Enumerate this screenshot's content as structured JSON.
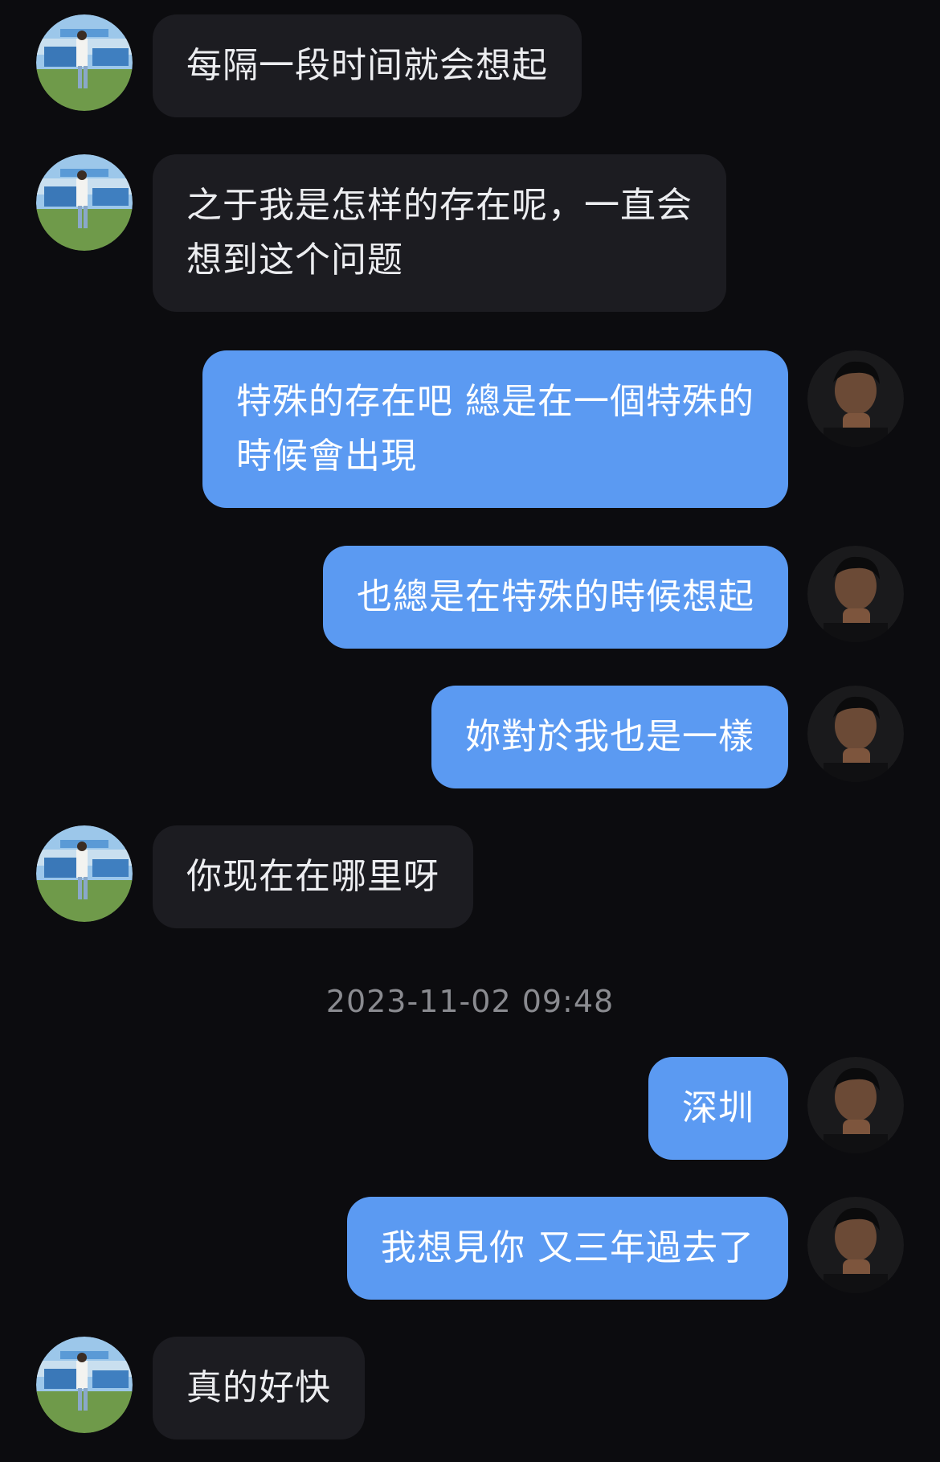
{
  "contacts": {
    "her": {
      "avatar_icon": "avatar-photo-girl-field"
    },
    "me": {
      "avatar_icon": "avatar-photo-man-dark"
    }
  },
  "colors": {
    "background": "#0c0c0f",
    "incoming_bubble": "#1c1c21",
    "outgoing_bubble": "#5b9af2",
    "timestamp": "#8a8b90"
  },
  "messages": [
    {
      "from": "her",
      "text": "每隔一段时间就会想起"
    },
    {
      "from": "her",
      "text": "之于我是怎样的存在呢，一直会\n想到这个问题"
    },
    {
      "from": "me",
      "text": "特殊的存在吧 總是在一個特殊的\n時候會出現"
    },
    {
      "from": "me",
      "text": "也總是在特殊的時候想起"
    },
    {
      "from": "me",
      "text": "妳對於我也是一樣"
    },
    {
      "from": "her",
      "text": "你现在在哪里呀"
    },
    {
      "from": "me",
      "text": "深圳"
    },
    {
      "from": "me",
      "text": "我想見你 又三年過去了"
    },
    {
      "from": "her",
      "text": "真的好快"
    }
  ],
  "timestamp_divider": "2023-11-02 09:48"
}
